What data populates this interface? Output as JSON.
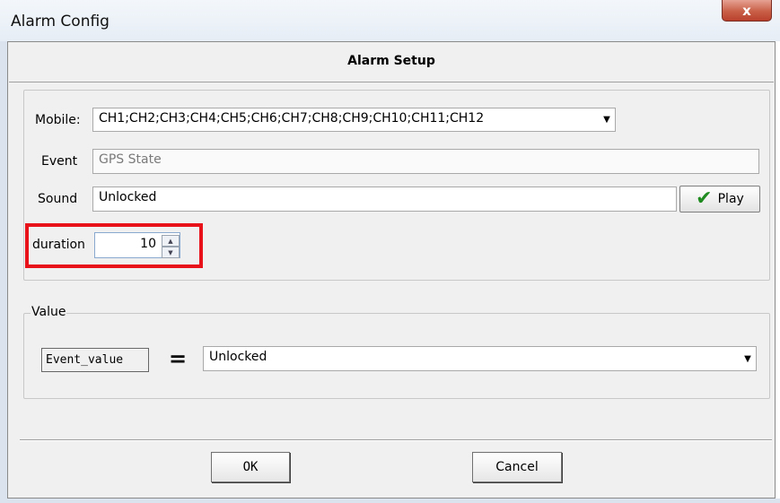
{
  "window": {
    "title": "Alarm Config",
    "close_label": "x"
  },
  "header": {
    "title": "Alarm Setup"
  },
  "form": {
    "mobile": {
      "label": "Mobile:",
      "value": "CH1;CH2;CH3;CH4;CH5;CH6;CH7;CH8;CH9;CH10;CH11;CH12"
    },
    "event": {
      "label": "Event",
      "value": "GPS State"
    },
    "sound": {
      "label": "Sound",
      "value": "Unlocked"
    },
    "play_label": "Play",
    "duration": {
      "label": "duration",
      "value": "10"
    }
  },
  "value_group": {
    "legend": "Value",
    "field_name": "Event_value",
    "operator": "=",
    "selected": "Unlocked"
  },
  "buttons": {
    "ok": "OK",
    "cancel": "Cancel"
  },
  "colors": {
    "highlight": "#e8121a",
    "close": "#c95f47"
  },
  "icons": {
    "play": "checkmark-icon",
    "close": "close-icon"
  }
}
